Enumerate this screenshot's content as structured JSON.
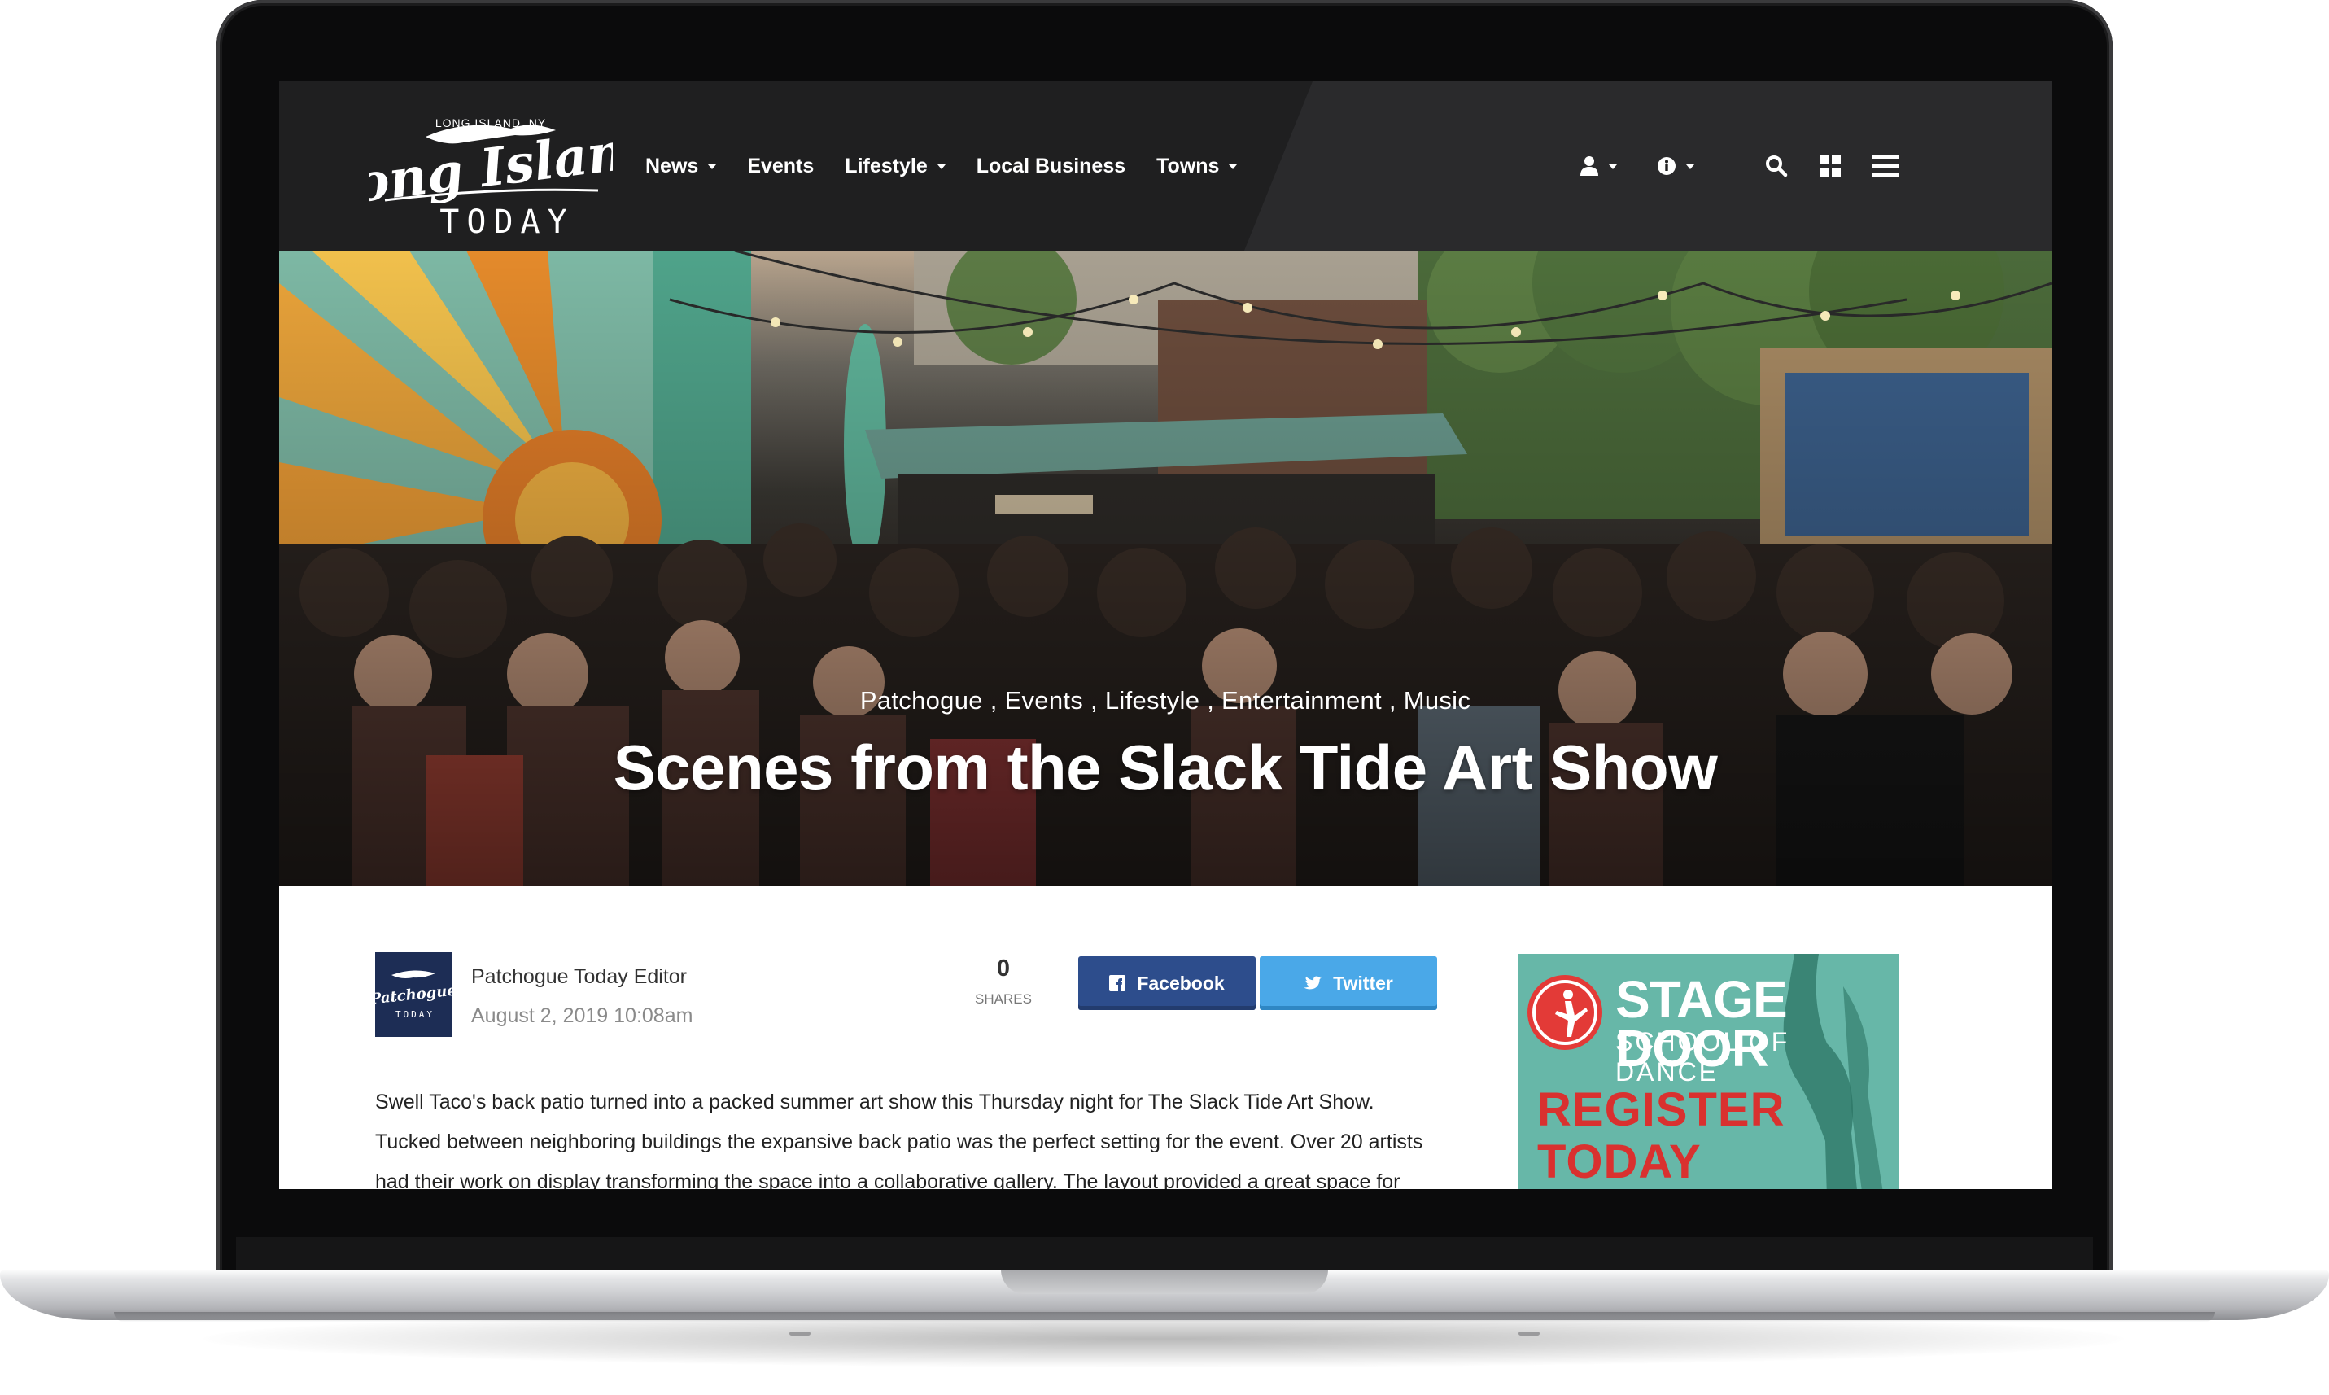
{
  "site": {
    "logo": {
      "top": "LONG ISLAND, NY",
      "script": "Long Island",
      "bottom": "TODAY"
    }
  },
  "nav": {
    "items": [
      {
        "label": "News",
        "dropdown": true
      },
      {
        "label": "Events",
        "dropdown": false
      },
      {
        "label": "Lifestyle",
        "dropdown": true
      },
      {
        "label": "Local Business",
        "dropdown": false
      },
      {
        "label": "Towns",
        "dropdown": true
      }
    ],
    "utility_icons": [
      "user-icon",
      "info-icon",
      "search-icon",
      "grid-icon",
      "hamburger-icon"
    ]
  },
  "hero": {
    "categories": [
      "Patchogue",
      "Events",
      "Lifestyle",
      "Entertainment",
      "Music"
    ],
    "category_separator": " , ",
    "title": "Scenes from the Slack Tide Art Show"
  },
  "post": {
    "author": "Patchogue Today Editor",
    "date": "August 2, 2019 10:08am",
    "avatar_text": "Patchogue",
    "avatar_sub": "TODAY",
    "shares": {
      "count": "0",
      "label": "SHARES"
    },
    "buttons": {
      "facebook": "Facebook",
      "twitter": "Twitter"
    },
    "paragraph_lines": [
      "Swell Taco's back patio turned into a packed summer art show this Thursday night for The Slack Tide Art Show.",
      "Tucked between neighboring buildings the expansive back patio was the perfect setting for the event.  Over 20 artists",
      "had their work on display transforming the space into a collaborative gallery.  The layout provided a great space for"
    ]
  },
  "ad": {
    "name": "STAGE DOOR",
    "subtitle": "SCHOOL OF DANCE",
    "cta_line1": "REGISTER",
    "cta_line2": "TODAY"
  },
  "colors": {
    "nav_bg": "#1f1f20",
    "facebook": "#2d4d8c",
    "twitter": "#4aa8e8",
    "ad_bg": "#67b7a8",
    "ad_accent": "#d9312f"
  }
}
